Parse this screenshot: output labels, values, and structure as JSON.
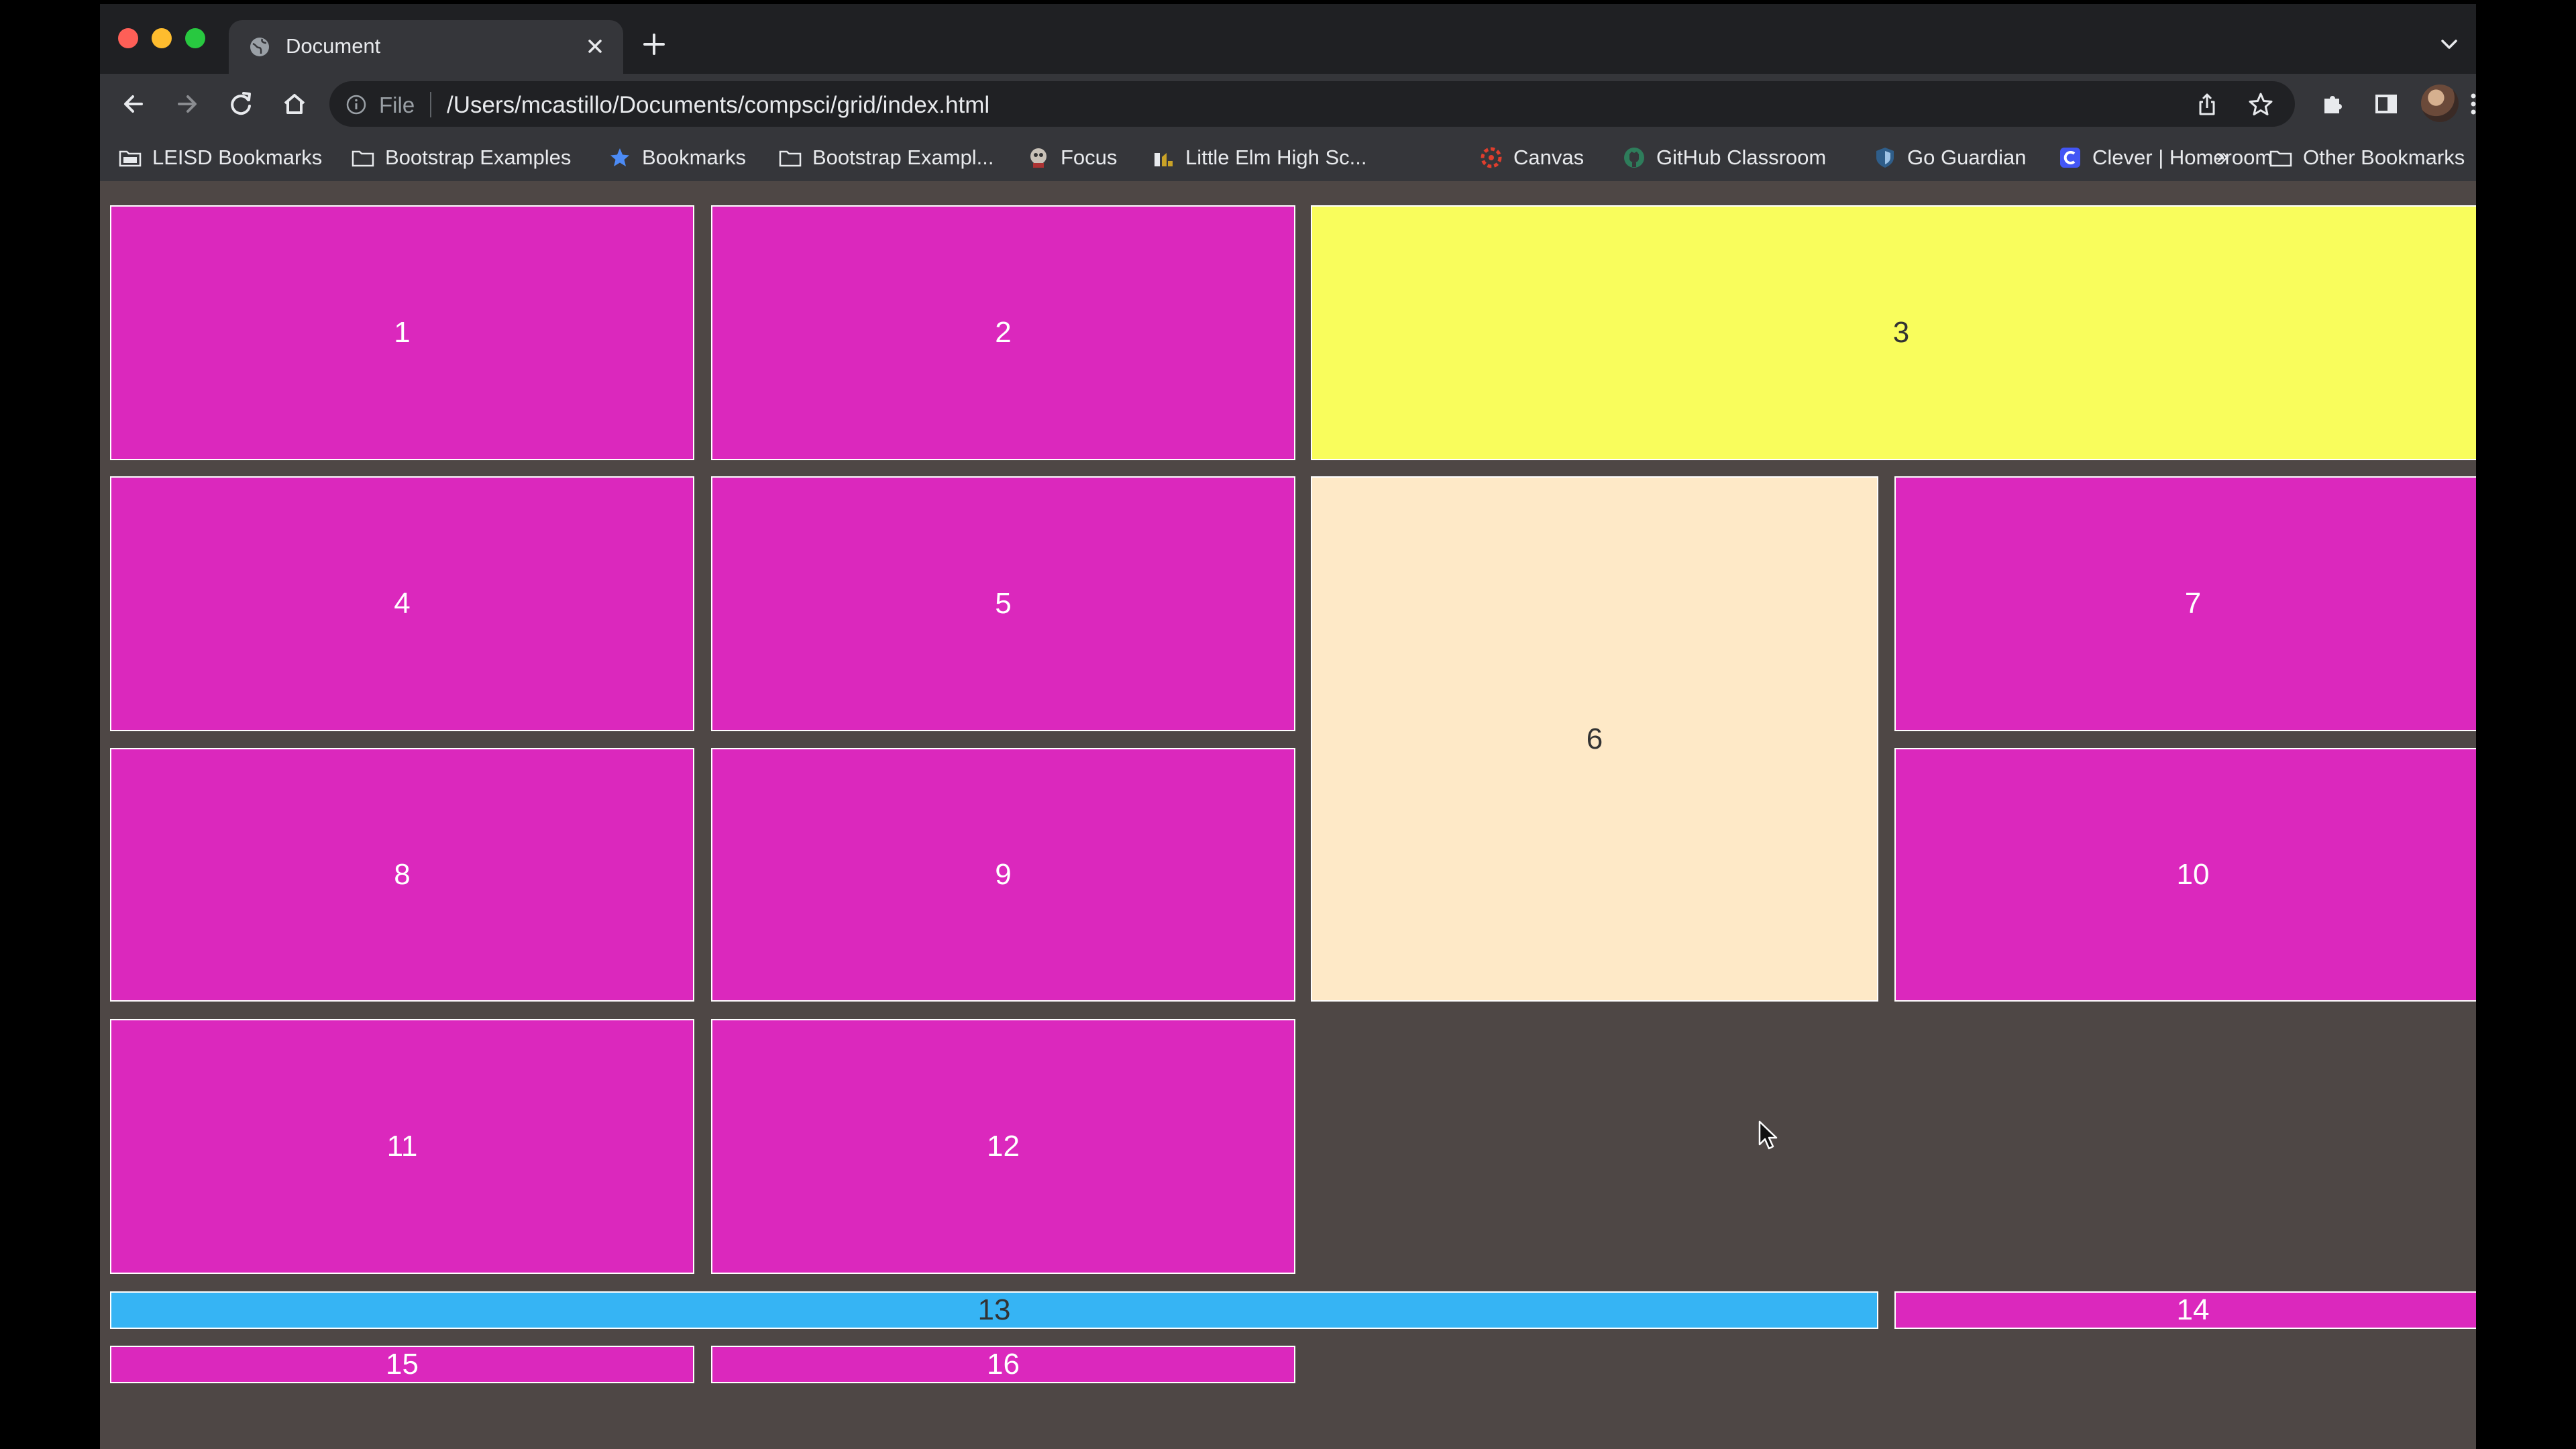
{
  "tab": {
    "title": "Document"
  },
  "omnibox": {
    "scheme": "File",
    "url": "/Users/mcastillo/Documents/compsci/grid/index.html"
  },
  "bookmarks": [
    {
      "label": "LEISD Bookmarks",
      "icon": "bookmark-folder-icon"
    },
    {
      "label": "Bootstrap Examples",
      "icon": "folder-icon"
    },
    {
      "label": "Bookmarks",
      "icon": "star-icon"
    },
    {
      "label": "Bootstrap Exampl...",
      "icon": "folder-icon"
    },
    {
      "label": "Focus",
      "icon": "focus-icon"
    },
    {
      "label": "Little Elm High Sc...",
      "icon": "school-icon"
    },
    {
      "label": "Canvas",
      "icon": "canvas-icon"
    },
    {
      "label": "GitHub Classroom",
      "icon": "github-icon"
    },
    {
      "label": "Go Guardian",
      "icon": "shield-icon"
    },
    {
      "label": "Clever | Homeroom",
      "icon": "clever-icon"
    }
  ],
  "bookmarks_more": "»",
  "other_bookmarks": "Other Bookmarks",
  "grid": {
    "colors": {
      "magenta": "#db28bd",
      "yellow": "#f9fd5c",
      "cream": "#fee9c7",
      "blue": "#36b4f4",
      "background": "#4e4745"
    },
    "cells": [
      "1",
      "2",
      "3",
      "4",
      "5",
      "6",
      "7",
      "8",
      "9",
      "10",
      "11",
      "12",
      "13",
      "14",
      "15",
      "16"
    ]
  }
}
